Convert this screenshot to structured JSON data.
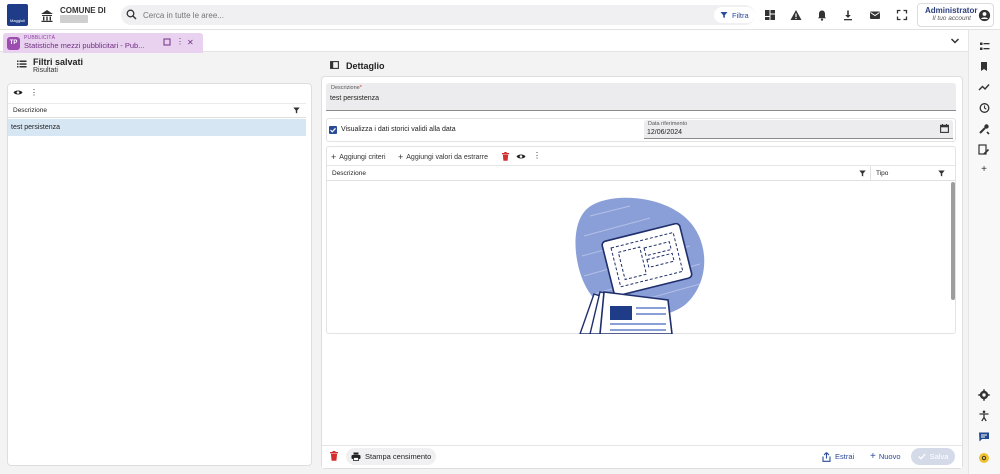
{
  "brand": {
    "logo_text": "Maggioli"
  },
  "header": {
    "comune": "COMUNE DI",
    "search_placeholder": "Cerca in tutte le aree...",
    "filter_label": "Filtra",
    "account_name": "Administrator",
    "account_sub": "Il tuo account"
  },
  "tab": {
    "kicker": "PUBBLICITÀ",
    "badge": "TP",
    "title": "Statistiche mezzi pubblicitari - Pub..."
  },
  "left": {
    "title": "Filtri salvati",
    "subtitle": "Risultati",
    "column": "Descrizione",
    "rows": [
      "test persistenza"
    ]
  },
  "detail": {
    "title": "Dettaglio",
    "desc_label": "Descrizione",
    "desc_required": "*",
    "desc_value": "test persistenza",
    "history_label": "Visualizza i dati storici validi alla data",
    "history_checked": true,
    "date_label": "Data riferimento",
    "date_value": "12/06/2024",
    "add_criteria": "Aggiungi criteri",
    "add_values": "Aggiungi valori da estrarre",
    "grid_columns": [
      "Descrizione",
      "Tipo"
    ]
  },
  "footer": {
    "print_label": "Stampa censimento",
    "extract_label": "Estrai",
    "new_label": "Nuovo",
    "save_label": "Salva"
  },
  "colors": {
    "accent": "#2a4a9a",
    "tab_bg": "#e9d2ef",
    "selected_row": "#d7e6f3"
  },
  "icons": {
    "top": [
      "dashboard-icon",
      "warning-icon",
      "bell-icon",
      "download-icon",
      "mail-icon",
      "fullscreen-icon",
      "account-icon"
    ],
    "right": [
      "list-icon",
      "bookmark-icon",
      "trend-icon",
      "history-icon",
      "tools-icon",
      "edit-note-icon",
      "add-icon",
      "settings-icon",
      "accessibility-icon",
      "chat-icon",
      "help-icon"
    ]
  }
}
